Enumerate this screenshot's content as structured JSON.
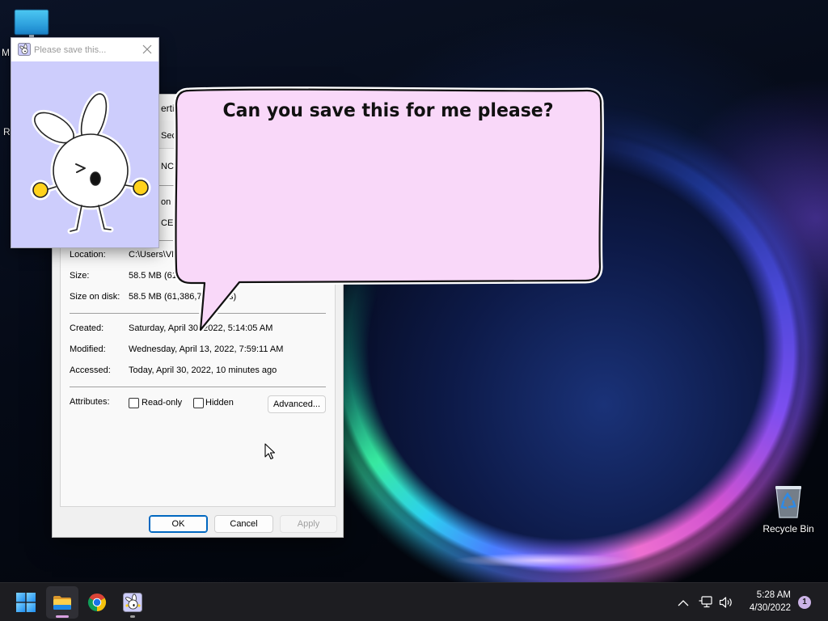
{
  "desktop": {
    "icons": [
      {
        "label": "M",
        "icon": "monitor-icon"
      },
      {
        "label": "R"
      },
      {
        "label": "Recycle Bin",
        "icon": "recycle-bin-icon"
      }
    ]
  },
  "properties_dialog": {
    "title_fragment": "erti",
    "tab_fragment": "Sec",
    "name_fragment": "NCE",
    "type_fragment": "on (",
    "description_fragment": "CE.",
    "rows": [
      {
        "label": "Location:",
        "value": "C:\\Users\\VM"
      },
      {
        "label": "Size:",
        "value": "58.5 MB (61,"
      },
      {
        "label": "Size on disk:",
        "value": "58.5 MB (61,386,7",
        "value_tail": "s)"
      },
      {
        "label": "Created:",
        "value": "Saturday, April 30, 2022, 5:14:05 AM"
      },
      {
        "label": "Modified:",
        "value": "Wednesday, April 13, 2022, 7:59:11 AM"
      },
      {
        "label": "Accessed:",
        "value": "Today, April 30, 2022, 10 minutes ago"
      }
    ],
    "attributes": {
      "label": "Attributes:",
      "read_only": {
        "label": "Read-only",
        "checked": false
      },
      "hidden": {
        "label": "Hidden",
        "checked": false
      },
      "advanced_label": "Advanced..."
    },
    "buttons": {
      "ok": "OK",
      "cancel": "Cancel",
      "apply": "Apply",
      "apply_enabled": false
    }
  },
  "popup_window": {
    "title": "Please save this...",
    "icon": "bunny-app-icon",
    "body_color": "#cdcdfc",
    "image": "bunny-character"
  },
  "speech_bubble": {
    "text": "Can you save this for me please?",
    "fill": "#f9d8f9",
    "outline": "#111111"
  },
  "taskbar": {
    "pinned": [
      {
        "icon": "windows-start-icon"
      },
      {
        "icon": "file-explorer-icon",
        "active": true
      },
      {
        "icon": "chrome-icon"
      },
      {
        "icon": "bunny-app-icon",
        "running": true
      }
    ],
    "tray": {
      "icons": [
        "chevron-up-icon",
        "network-icon",
        "volume-icon"
      ],
      "time": "5:28 AM",
      "date": "4/30/2022",
      "notification_count": "1"
    }
  },
  "colors": {
    "accent": "#0067c0",
    "taskbar_bg": "#1d1d21",
    "active_indicator": "#d9a0e0",
    "badge": "#cbb3e6"
  }
}
